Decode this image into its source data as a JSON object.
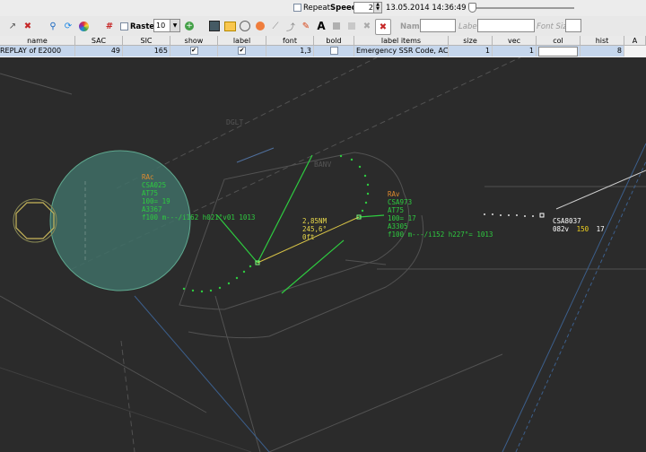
{
  "topbar": {
    "repeat_label": "Repeat",
    "speed_label": "Speed:",
    "speed_value": "2",
    "datetime": "13.05.2014 14:36:49"
  },
  "toolbar": {
    "raster_label": "Raster",
    "raster_value": "10",
    "text_icon": "A",
    "name_label": "Name",
    "label_label": "Label",
    "font_size_label": "Font Size"
  },
  "table": {
    "headers": [
      "name",
      "SAC",
      "SIC",
      "show",
      "label",
      "font",
      "bold",
      "label items",
      "size",
      "vec",
      "col",
      "hist"
    ],
    "header_overflow": "A",
    "row": {
      "name": "REPLAY of E2000",
      "sac": "49",
      "sic": "165",
      "font": "1,3",
      "label_items": "Emergency SSR Code, ACA...",
      "size": "1",
      "vec": "1",
      "hist": "8"
    }
  },
  "map": {
    "waypoint1": "DGLT",
    "waypoint2": "BANV",
    "track1": {
      "line1": "RAc",
      "line2": "CSA025",
      "line3": "AT75",
      "line4": "100= 19",
      "line5": "A3367",
      "line6": "f100 m---/i162 h021°v01 1013"
    },
    "track2": {
      "line1": "RAv",
      "line2": "CSA973",
      "line3": "AT75",
      "line4": "100= 17",
      "line5": "A3305",
      "line6": "f100 m---/i152 h227°=   1013"
    },
    "measure": {
      "line1": "2,85NM",
      "line2": "245,6°",
      "line3": "0ft"
    },
    "track3": {
      "line1": "CSA8037",
      "line2_a": "082v",
      "line2_b": "150",
      "line2_c": "17"
    }
  }
}
